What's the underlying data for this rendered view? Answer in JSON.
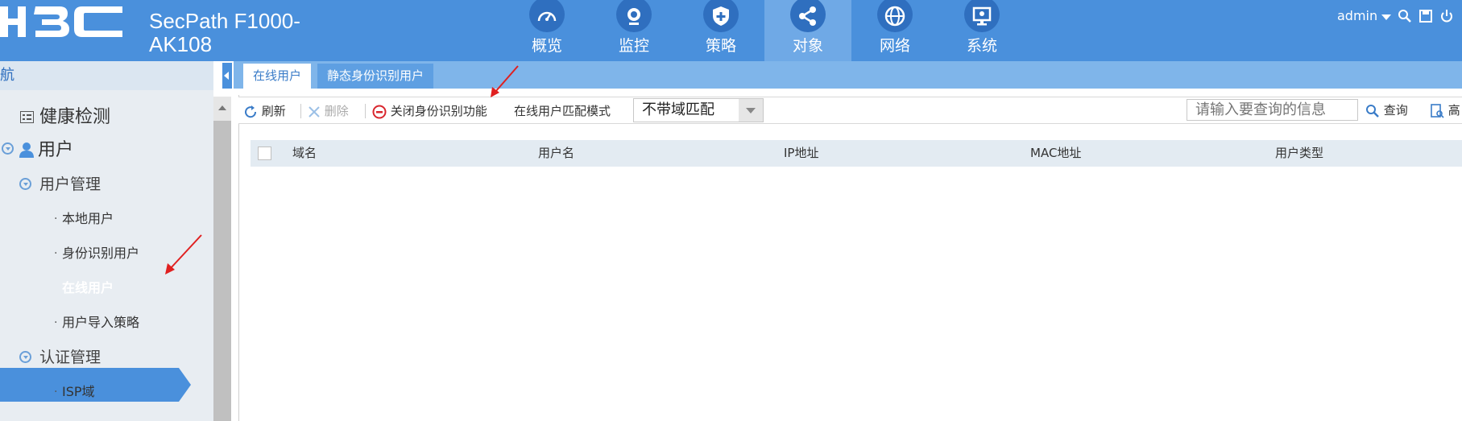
{
  "header": {
    "product_line1": "SecPath F1000-",
    "product_line2": "AK108",
    "nav": [
      {
        "label": "概览",
        "icon": "dashboard-icon"
      },
      {
        "label": "监控",
        "icon": "monitor-camera-icon"
      },
      {
        "label": "策略",
        "icon": "shield-icon"
      },
      {
        "label": "对象",
        "icon": "share-nodes-icon"
      },
      {
        "label": "网络",
        "icon": "globe-icon"
      },
      {
        "label": "系统",
        "icon": "computer-icon"
      }
    ],
    "active_nav": "对象",
    "user": "admin"
  },
  "sidebar": {
    "title": "航",
    "items": [
      {
        "label": "健康检测"
      },
      {
        "label": "用户"
      },
      {
        "label": "用户管理"
      },
      {
        "label": "本地用户"
      },
      {
        "label": "身份识别用户"
      },
      {
        "label": "在线用户"
      },
      {
        "label": "用户导入策略"
      },
      {
        "label": "认证管理"
      },
      {
        "label": "ISP域"
      }
    ],
    "selected": "在线用户"
  },
  "tabs": [
    {
      "label": "在线用户"
    },
    {
      "label": "静态身份识别用户"
    }
  ],
  "toolbar": {
    "refresh": "刷新",
    "delete": "删除",
    "disable_identity": "关闭身份识别功能",
    "match_mode_label": "在线用户匹配模式",
    "match_mode_value": "不带域匹配",
    "search_placeholder": "请输入要查询的信息",
    "query": "查询",
    "advanced": "高"
  },
  "table": {
    "columns": [
      "域名",
      "用户名",
      "IP地址",
      "MAC地址",
      "用户类型"
    ],
    "rows": []
  },
  "colors": {
    "header_bg": "#4a90dc",
    "active_nav_bg": "#6fa9e6",
    "sidebar_selected": "#4a90dc"
  }
}
